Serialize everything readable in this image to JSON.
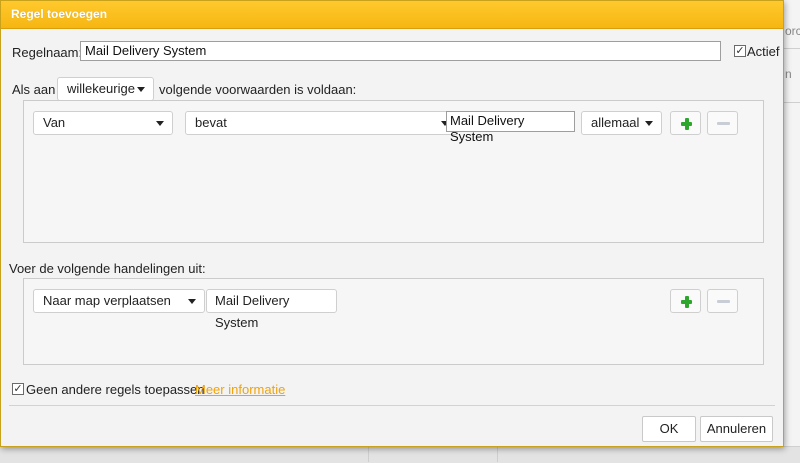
{
  "dialog": {
    "title": "Regel toevoegen",
    "rule_name_label": "Regelnaam:",
    "rule_name_value": "Mail Delivery System",
    "active_label": "Actief",
    "active_checked": true,
    "conditions": {
      "prefix": "Als aan",
      "match_select": "willekeurige",
      "suffix": "volgende voorwaarden is voldaan:",
      "rows": [
        {
          "field": "Van",
          "operator": "bevat",
          "value": "Mail Delivery System",
          "scope": "allemaal"
        }
      ]
    },
    "actions": {
      "heading": "Voer de volgende handelingen uit:",
      "rows": [
        {
          "action": "Naar map verplaatsen",
          "target": "Mail Delivery System"
        }
      ]
    },
    "stop_rules_label": "Geen andere regels toepassen",
    "stop_rules_checked": true,
    "more_info_link": "Meer informatie",
    "ok_label": "OK",
    "cancel_label": "Annuleren"
  },
  "background": {
    "snippet_top": "orc",
    "snippet_mid": "n"
  },
  "colors": {
    "titlebar": "#f6b612",
    "link": "#f0a30a",
    "add_icon": "#2ea62e"
  },
  "icons": {
    "add": "plus-icon",
    "remove": "minus-icon",
    "dropdown": "chevron-down-icon",
    "check": "check-icon"
  }
}
